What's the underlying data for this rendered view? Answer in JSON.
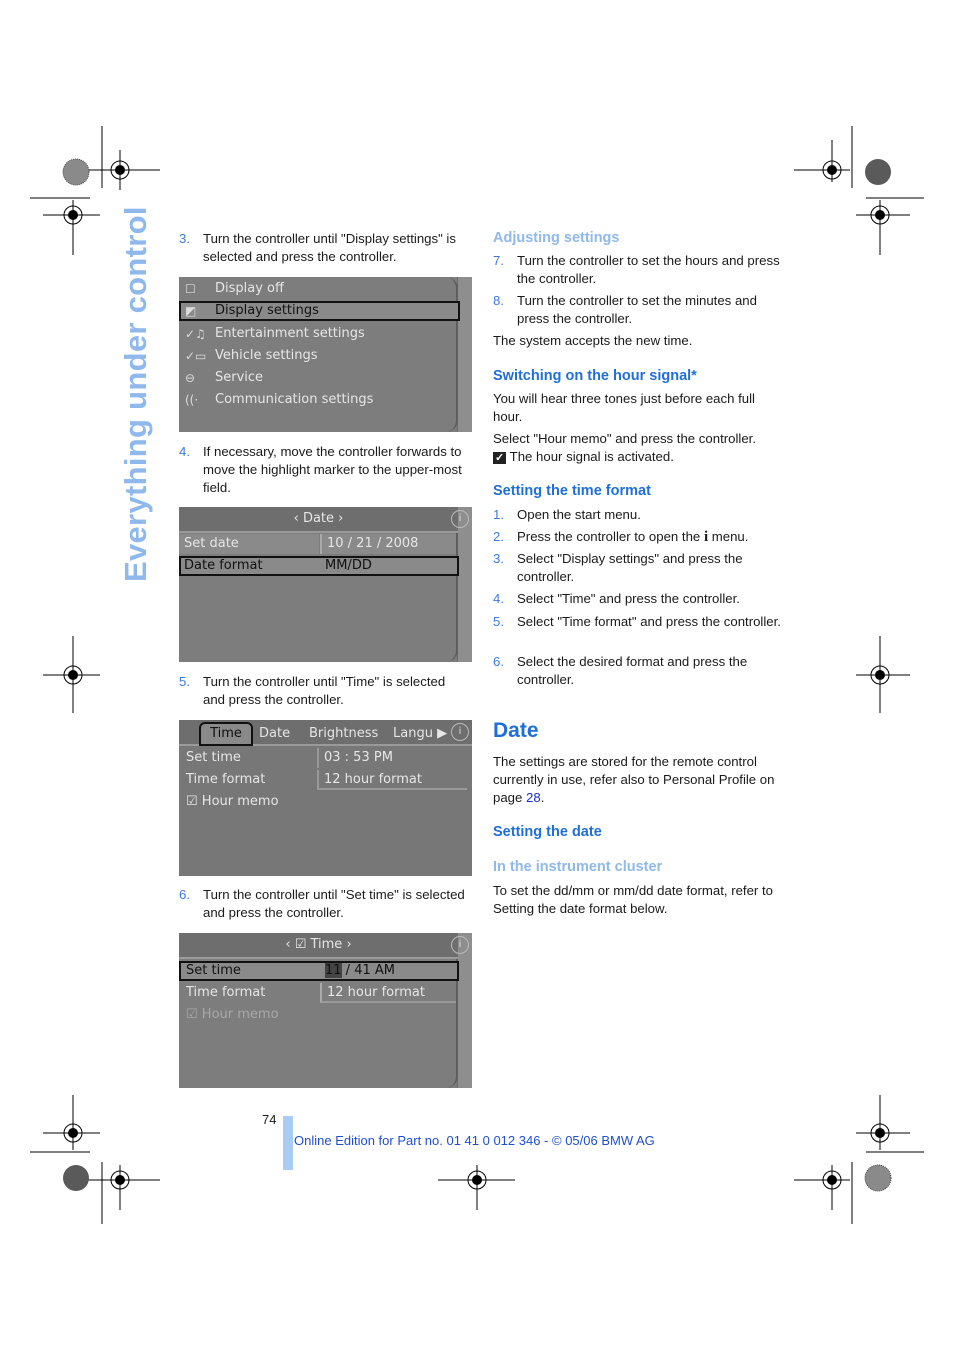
{
  "sidebar": {
    "title": "Everything under control"
  },
  "left": {
    "steps": [
      {
        "num": "3.",
        "text": "Turn the controller until \"Display settings\" is selected and press the controller."
      },
      {
        "num": "4.",
        "text": "If necessary, move the controller forwards to move the highlight marker to the upper-most field."
      },
      {
        "num": "5.",
        "text": "Turn the controller until \"Time\" is selected and press the controller."
      },
      {
        "num": "6.",
        "text": "Turn the controller until \"Set time\" is selected and press the controller."
      }
    ],
    "screen1": {
      "items": [
        {
          "icon": "display-off-icon",
          "glyph": "☐",
          "label": "Display off"
        },
        {
          "icon": "display-settings-icon",
          "glyph": "◩",
          "label": "Display settings",
          "selected": true
        },
        {
          "icon": "entertainment-settings-icon",
          "glyph": "✓♫",
          "label": "Entertainment settings"
        },
        {
          "icon": "vehicle-settings-icon",
          "glyph": "✓▭",
          "label": "Vehicle settings"
        },
        {
          "icon": "service-icon",
          "glyph": "⊖",
          "label": "Service"
        },
        {
          "icon": "communication-icon",
          "glyph": "((·",
          "label": "Communication settings"
        }
      ]
    },
    "screen2": {
      "header": "‹ Date ›",
      "rows": [
        {
          "label": "Set date",
          "value": "10 / 21 / 2008"
        },
        {
          "label": "Date format",
          "value": "MM/DD",
          "selected": true
        }
      ]
    },
    "screen3": {
      "tabs": [
        "Time",
        "Date",
        "Brightness",
        "Langu ▶"
      ],
      "rows": [
        {
          "label": "Set time",
          "value": "03 : 53 PM"
        },
        {
          "label": "Time format",
          "value": "12 hour format"
        }
      ],
      "checkbox": "Hour memo"
    },
    "screen4": {
      "header": "Time",
      "rows": [
        {
          "label": "Set time",
          "value_highlight": "11",
          "value_rest": " / 41 AM",
          "selected": true
        },
        {
          "label": "Time format",
          "value": "12 hour format"
        }
      ],
      "checkbox": "Hour memo"
    }
  },
  "right": {
    "adjusting": {
      "heading": "Adjusting settings",
      "steps": [
        {
          "num": "7.",
          "text": "Turn the controller to set the hours and press the controller."
        },
        {
          "num": "8.",
          "text": "Turn the controller to set the minutes and press the controller."
        }
      ],
      "after": "The system accepts the new time."
    },
    "hour_signal": {
      "heading": "Switching on the hour signal*",
      "p1": "You will hear three tones just before each full hour.",
      "p2": "Select \"Hour memo\" and press the controller.",
      "p3": "The hour signal is activated."
    },
    "time_format": {
      "heading": "Setting the time format",
      "steps": [
        {
          "num": "1.",
          "text": "Open the start menu."
        },
        {
          "num": "2.",
          "text_before": "Press the controller to open the ",
          "icon": "i",
          "text_after": " menu."
        },
        {
          "num": "3.",
          "text": "Select \"Display settings\" and press the controller."
        },
        {
          "num": "4.",
          "text": "Select \"Time\" and press the controller."
        },
        {
          "num": "5.",
          "text": "Select \"Time format\" and press the controller."
        },
        {
          "num": "6.",
          "text": "Select the desired format and press the controller."
        }
      ]
    },
    "date": {
      "heading": "Date",
      "p1_before": "The settings are stored for the remote control currently in use, refer also to Personal Profile on page ",
      "p1_link": "28",
      "p1_after": ".",
      "sub_heading": "Setting the date",
      "sub_sub_heading": "In the instrument cluster",
      "p2": "To set the dd/mm or mm/dd date format, refer to Setting the date format below."
    }
  },
  "footer": {
    "page_number": "74",
    "edition": "Online Edition for Part no. 01 41 0 012 346 - © 05/06 BMW AG"
  },
  "colors": {
    "accent": "#1f6fd8",
    "accent_light": "#8fb8ec",
    "link": "#1b2fd0",
    "screen_bg": "#7d7d7d"
  }
}
